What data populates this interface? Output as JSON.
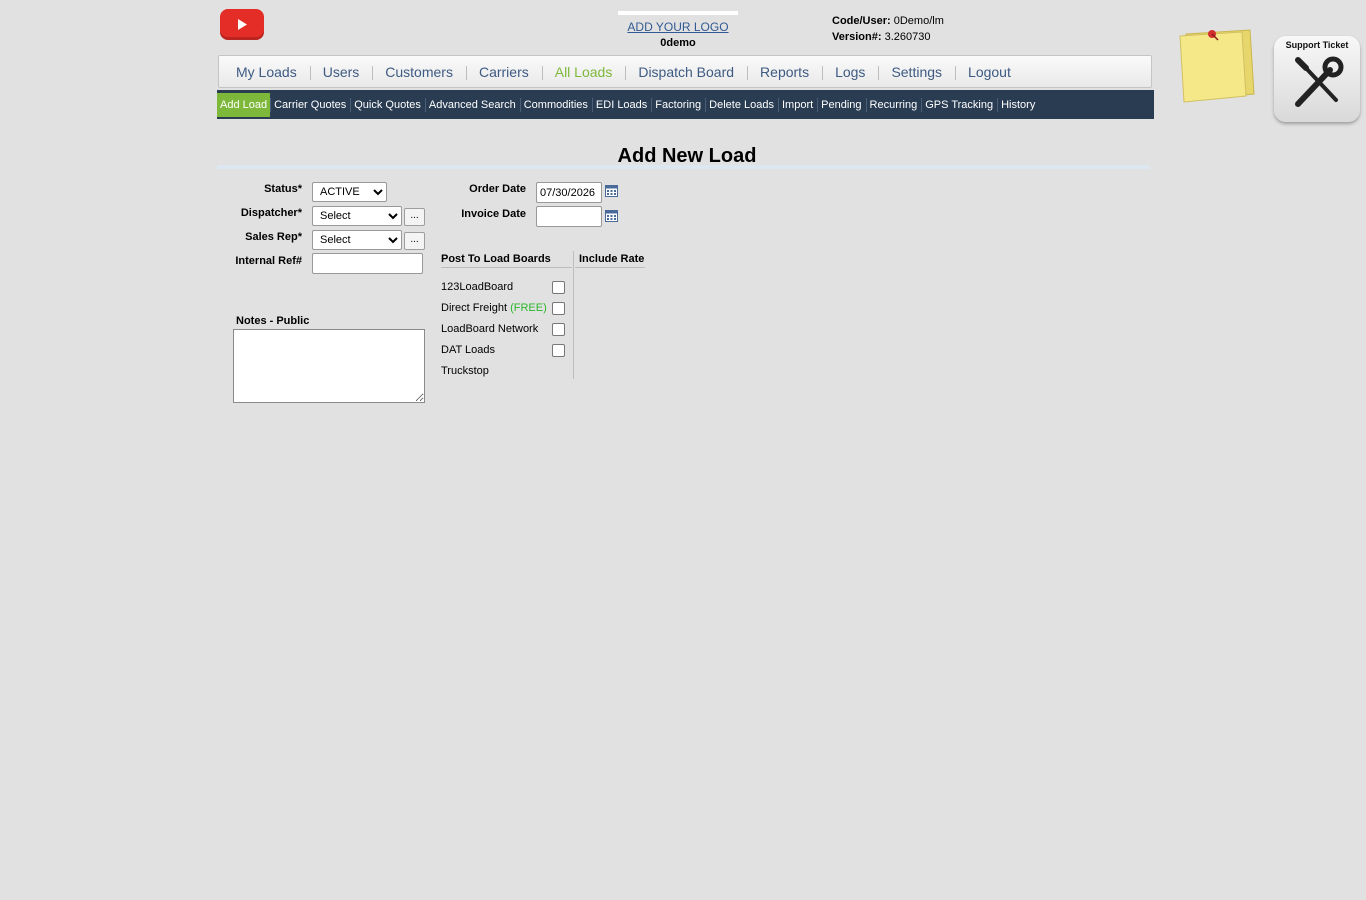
{
  "header": {
    "youtube_icon": "youtube-play-icon",
    "logo_link": "ADD YOUR LOGO",
    "company": "0demo",
    "code_user_label": "Code/User:",
    "code_user_value": "0Demo/lm",
    "version_label": "Version#:",
    "version_value": "3.260730"
  },
  "main_nav": {
    "items": [
      "My Loads",
      "Users",
      "Customers",
      "Carriers",
      "All Loads",
      "Dispatch Board",
      "Reports",
      "Logs",
      "Settings",
      "Logout"
    ],
    "active": "All Loads",
    "active_color": "#7db83a",
    "link_color": "#3d5a83"
  },
  "sub_nav": {
    "items": [
      "Add Load",
      "Carrier Quotes",
      "Quick Quotes",
      "Advanced Search",
      "Commodities",
      "EDI Loads",
      "Factoring",
      "Delete Loads",
      "Import",
      "Pending",
      "Recurring",
      "GPS Tracking",
      "History"
    ],
    "active": "Add Load",
    "bg_color": "#293c52"
  },
  "widgets": {
    "sticky_note_icon": "sticky-note-icon",
    "support_label": "Support Ticket",
    "support_icon": "wrench-screwdriver-icon"
  },
  "page": {
    "title": "Add New Load"
  },
  "form": {
    "status_label": "Status*",
    "status_value": "ACTIVE",
    "dispatcher_label": "Dispatcher*",
    "dispatcher_value": "Select",
    "salesrep_label": "Sales Rep*",
    "salesrep_value": "Select",
    "internal_ref_label": "Internal Ref#",
    "internal_ref_value": "",
    "more_button": "...",
    "order_date_label": "Order Date",
    "order_date_value": "07/30/2026",
    "invoice_date_label": "Invoice Date",
    "invoice_date_value": "",
    "calendar_icon": "calendar-icon",
    "notes_label": "Notes - Public",
    "notes_value": ""
  },
  "load_boards": {
    "post_header": "Post To Load Boards",
    "rate_header": "Include Rate",
    "boards": [
      {
        "name": "123LoadBoard",
        "suffix": "",
        "checked": false,
        "has_checkbox": true
      },
      {
        "name": "Direct Freight",
        "suffix": "(FREE)",
        "checked": false,
        "has_checkbox": true
      },
      {
        "name": "LoadBoard Network",
        "suffix": "",
        "checked": false,
        "has_checkbox": true
      },
      {
        "name": "DAT Loads",
        "suffix": "",
        "checked": false,
        "has_checkbox": true
      },
      {
        "name": "Truckstop",
        "suffix": "",
        "checked": false,
        "has_checkbox": false
      }
    ],
    "free_color": "#2bb62b"
  }
}
